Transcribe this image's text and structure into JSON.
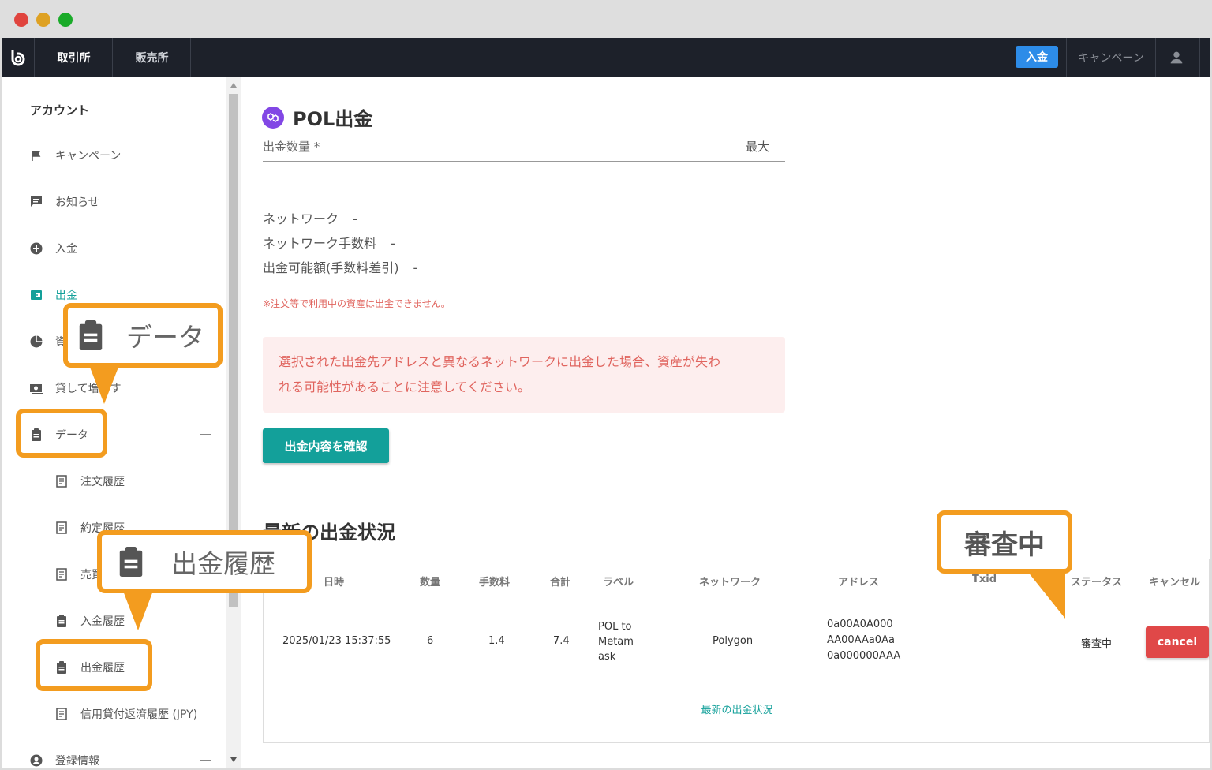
{
  "topnav": {
    "tab_exchange": "取引所",
    "tab_store": "販売所",
    "deposit_button": "入金",
    "campaign_link": "キャンペーン"
  },
  "sidebar": {
    "title": "アカウント",
    "items": [
      {
        "label": "キャンペーン",
        "icon": "flag-icon"
      },
      {
        "label": "お知らせ",
        "icon": "message-icon"
      },
      {
        "label": "入金",
        "icon": "plus-circle-icon"
      },
      {
        "label": "出金",
        "icon": "wallet-icon"
      },
      {
        "label": "資",
        "icon": "pie-chart-icon"
      },
      {
        "label": "貸して増やす",
        "icon": "cash-icon"
      },
      {
        "label": "データ",
        "icon": "clipboard-icon"
      },
      {
        "label": "注文履歴",
        "icon": "document-icon"
      },
      {
        "label": "約定履歴",
        "icon": "document-icon"
      },
      {
        "label": "売買",
        "icon": "document-icon"
      },
      {
        "label": "入金履歴",
        "icon": "clipboard-icon"
      },
      {
        "label": "出金履歴",
        "icon": "clipboard-icon"
      },
      {
        "label": "信用貸付返済履歴 (JPY)",
        "icon": "document-icon"
      },
      {
        "label": "登録情報",
        "icon": "account-circle-icon"
      }
    ]
  },
  "main": {
    "title": "POL出金",
    "amount_label": "出金数量 *",
    "max_label": "最大",
    "network_label": "ネットワーク",
    "network_value": "-",
    "fee_label": "ネットワーク手数料",
    "fee_value": "-",
    "available_label": "出金可能額(手数料差引)",
    "available_value": "-",
    "note": "※注文等で利用中の資産は出金できません。",
    "warning_line1": "選択された出金先アドレスと異なるネットワークに出金した場合、資産が失わ",
    "warning_line2": "れる可能性があることに注意してください。",
    "confirm_button": "出金内容を確認",
    "section_title": "最新の出金状況"
  },
  "table": {
    "headers": [
      "日時",
      "数量",
      "手数料",
      "合計",
      "ラベル",
      "ネットワーク",
      "アドレス",
      "Txid",
      "ステータス",
      "キャンセル"
    ],
    "row": {
      "datetime": "2025/01/23 15:37:55",
      "quantity": "6",
      "fee": "1.4",
      "total": "7.4",
      "label_l1": "POL to",
      "label_l2": "Metam",
      "label_l3": "ask",
      "network": "Polygon",
      "address_l1": "0a00A0A000",
      "address_l2": "AA00AAa0Aa",
      "address_l3": "0a000000AAA",
      "status": "審査中",
      "cancel": "cancel"
    },
    "more_link": "最新の出金状況"
  },
  "callouts": {
    "data_label": "データ",
    "history_label": "出金履歴",
    "status_label": "審査中"
  },
  "colors": {
    "accent": "#13a09a",
    "callout": "#f39c1f",
    "danger": "#e04848",
    "nav_bg": "#1d212a",
    "pol": "#8247e5"
  }
}
